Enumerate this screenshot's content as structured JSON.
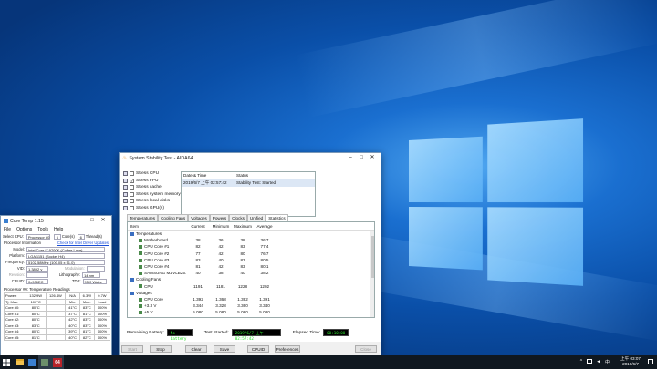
{
  "taskbar": {
    "clock_time": "上午 03:07",
    "clock_date": "2019/6/7",
    "aida_icon_label": "64"
  },
  "coretemp": {
    "title": "Core Temp 1.15",
    "menu": [
      "File",
      "Options",
      "Tools",
      "Help"
    ],
    "select_cpu_label": "Select CPU:",
    "select_cpu_value": "Processor #0",
    "cores_value": "6",
    "cores_label": "Core(s)",
    "threads_value": "6",
    "threads_label": "Thread(s)",
    "proc_info_label": "Processor Information",
    "driver_link": "Check for Intel Driver Updates",
    "model_label": "Model:",
    "model_value": "Intel Core i7 9700K (Coffee Lake)",
    "platform_label": "Platform:",
    "platform_value": "LGA 1151 (Socket H4)",
    "frequency_label": "Frequency:",
    "frequency_value": "5102.58MHz (100.05 x 51.0)",
    "vid_label": "VID:",
    "vid_value": "1.3892 v",
    "modulation_label": "Modulation:",
    "revision_label": "Revision:",
    "lithography_label": "Lithography:",
    "lithography_value": "14 nm",
    "cpuid_label": "CPUID:",
    "cpuid_value": "0x906EC",
    "tdp_label": "TDP:",
    "tdp_value": "95.0 Watts",
    "temp_section": "Processor #0: Temperature Readings",
    "power_row": [
      "Power:",
      "132.9W",
      "126.4W",
      "N/A",
      "6.3W",
      "0.7W"
    ],
    "tjmax_row": [
      "Tj. Max:",
      "100°C",
      "",
      "Min.",
      "Max.",
      "Load"
    ],
    "cores": [
      [
        "Core #0:",
        "80°C",
        "",
        "41°C",
        "83°C",
        "100%"
      ],
      [
        "Core #1:",
        "80°C",
        "",
        "37°C",
        "81°C",
        "100%"
      ],
      [
        "Core #2:",
        "80°C",
        "",
        "42°C",
        "83°C",
        "100%"
      ],
      [
        "Core #3:",
        "83°C",
        "",
        "40°C",
        "83°C",
        "100%"
      ],
      [
        "Core #4:",
        "80°C",
        "",
        "39°C",
        "81°C",
        "100%"
      ],
      [
        "Core #5:",
        "81°C",
        "",
        "40°C",
        "82°C",
        "100%"
      ]
    ]
  },
  "aida": {
    "title": "System Stability Test - AIDA64",
    "stress_items": [
      {
        "label": "Stress CPU",
        "checked": ""
      },
      {
        "label": "Stress FPU",
        "checked": "✓"
      },
      {
        "label": "Stress cache",
        "checked": ""
      },
      {
        "label": "Stress system memory",
        "checked": ""
      },
      {
        "label": "Stress local disks",
        "checked": ""
      },
      {
        "label": "Stress GPU(s)",
        "checked": ""
      }
    ],
    "status_header": {
      "date": "Date & Time",
      "status": "Status"
    },
    "status_row": {
      "date": "2019/6/7 上午 02:57:42",
      "status": "Stability Test: Started"
    },
    "tabs": [
      "Temperatures",
      "Cooling Fans",
      "Voltages",
      "Powers",
      "Clocks",
      "Unified",
      "Statistics"
    ],
    "columns": [
      "Item",
      "Current",
      "Minimum",
      "Maximum",
      "Average"
    ],
    "rows": [
      {
        "item": "Temperatures",
        "cur": "",
        "min": "",
        "max": "",
        "avg": "",
        "level": 0,
        "icon": "thermometer-icon"
      },
      {
        "item": "Motherboard",
        "cur": "38",
        "min": "36",
        "max": "38",
        "avg": "36.7",
        "level": 1,
        "icon": "motherboard-icon"
      },
      {
        "item": "CPU Core #1",
        "cur": "82",
        "min": "42",
        "max": "83",
        "avg": "77.4",
        "level": 1,
        "icon": "cpu-icon"
      },
      {
        "item": "CPU Core #2",
        "cur": "77",
        "min": "42",
        "max": "80",
        "avg": "76.7",
        "level": 1,
        "icon": "cpu-icon"
      },
      {
        "item": "CPU Core #3",
        "cur": "83",
        "min": "40",
        "max": "83",
        "avg": "80.5",
        "level": 1,
        "icon": "cpu-icon"
      },
      {
        "item": "CPU Core #4",
        "cur": "81",
        "min": "42",
        "max": "83",
        "avg": "80.1",
        "level": 1,
        "icon": "cpu-icon"
      },
      {
        "item": "SAMSUNG MZVLB25...",
        "cur": "40",
        "min": "38",
        "max": "40",
        "avg": "38.2",
        "level": 1,
        "icon": "disk-icon"
      },
      {
        "item": "Cooling Fans",
        "cur": "",
        "min": "",
        "max": "",
        "avg": "",
        "level": 0,
        "icon": "fan-icon"
      },
      {
        "item": "CPU",
        "cur": "1191",
        "min": "1181",
        "max": "1228",
        "avg": "1202",
        "level": 1,
        "icon": "cpu-icon"
      },
      {
        "item": "Voltages",
        "cur": "",
        "min": "",
        "max": "",
        "avg": "",
        "level": 0,
        "icon": "voltage-icon"
      },
      {
        "item": "CPU Core",
        "cur": "1.392",
        "min": "1.368",
        "max": "1.392",
        "avg": "1.391",
        "level": 1,
        "icon": "cpu-icon"
      },
      {
        "item": "+3.3 V",
        "cur": "3.344",
        "min": "3.328",
        "max": "3.360",
        "avg": "3.340",
        "level": 1,
        "icon": "voltage-icon"
      },
      {
        "item": "+5 V",
        "cur": "5.080",
        "min": "5.080",
        "max": "5.080",
        "avg": "5.080",
        "level": 1,
        "icon": "voltage-icon"
      }
    ],
    "remaining_battery_label": "Remaining Battery:",
    "remaining_battery_value": "No battery",
    "test_started_label": "Test Started:",
    "test_started_value": "2019/6/7 上午 02:57:42",
    "elapsed_label": "Elapsed Time:",
    "elapsed_value": "00:10:00",
    "buttons": {
      "start": "Start",
      "stop": "Stop",
      "clear": "Clear",
      "save": "Save",
      "cpuid": "CPUID",
      "preferences": "Preferences",
      "close": "Close"
    }
  }
}
